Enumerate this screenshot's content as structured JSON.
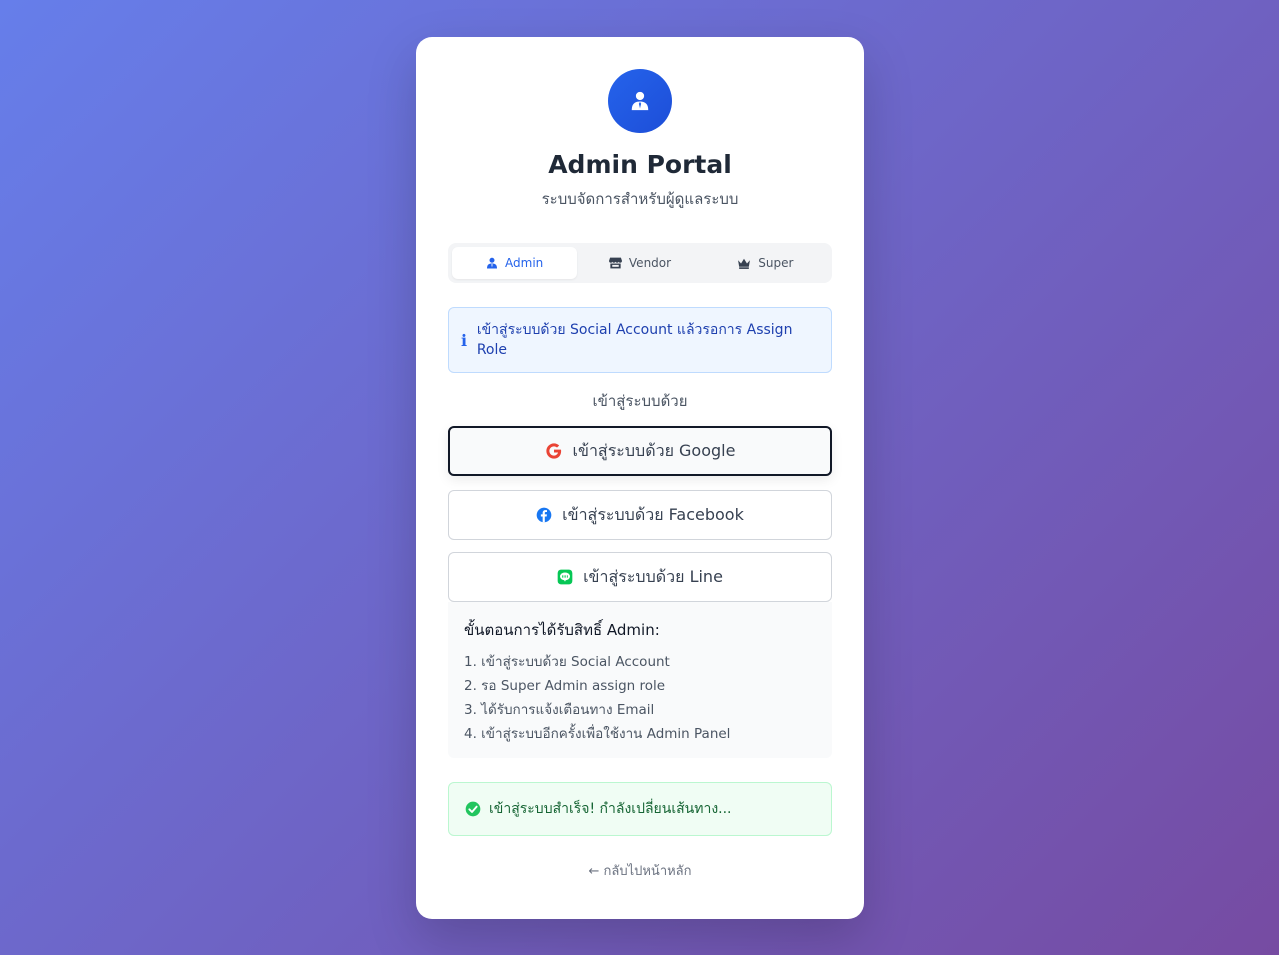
{
  "header": {
    "title": "Admin Portal",
    "subtitle": "ระบบจัดการสำหรับผู้ดูแลระบบ"
  },
  "tabs": [
    {
      "label": "Admin",
      "icon": "user-tie-icon",
      "active": true
    },
    {
      "label": "Vendor",
      "icon": "store-icon",
      "active": false
    },
    {
      "label": "Super",
      "icon": "crown-icon",
      "active": false
    }
  ],
  "info": {
    "text": "เข้าสู่ระบบด้วย Social Account แล้วรอการ Assign Role",
    "icon": "info-icon"
  },
  "login_with": "เข้าสู่ระบบด้วย",
  "buttons": {
    "google": "เข้าสู่ระบบด้วย Google",
    "facebook": "เข้าสู่ระบบด้วย Facebook",
    "line": "เข้าสู่ระบบด้วย Line"
  },
  "steps": {
    "title": "ขั้นตอนการได้รับสิทธิ์ Admin:",
    "items": [
      "1. เข้าสู่ระบบด้วย Social Account",
      "2. รอ Super Admin assign role",
      "3. ได้รับการแจ้งเตือนทาง Email",
      "4. เข้าสู่ระบบอีกครั้งเพื่อใช้งาน Admin Panel"
    ]
  },
  "success": {
    "text": "เข้าสู่ระบบสำเร็จ! กำลังเปลี่ยนเส้นทาง..."
  },
  "back_link": "← กลับไปหน้าหลัก",
  "colors": {
    "primary": "#2563eb",
    "google_red": "#ea4335",
    "facebook_blue": "#1877f2",
    "line_green": "#06c755",
    "success_green": "#22c55e"
  }
}
